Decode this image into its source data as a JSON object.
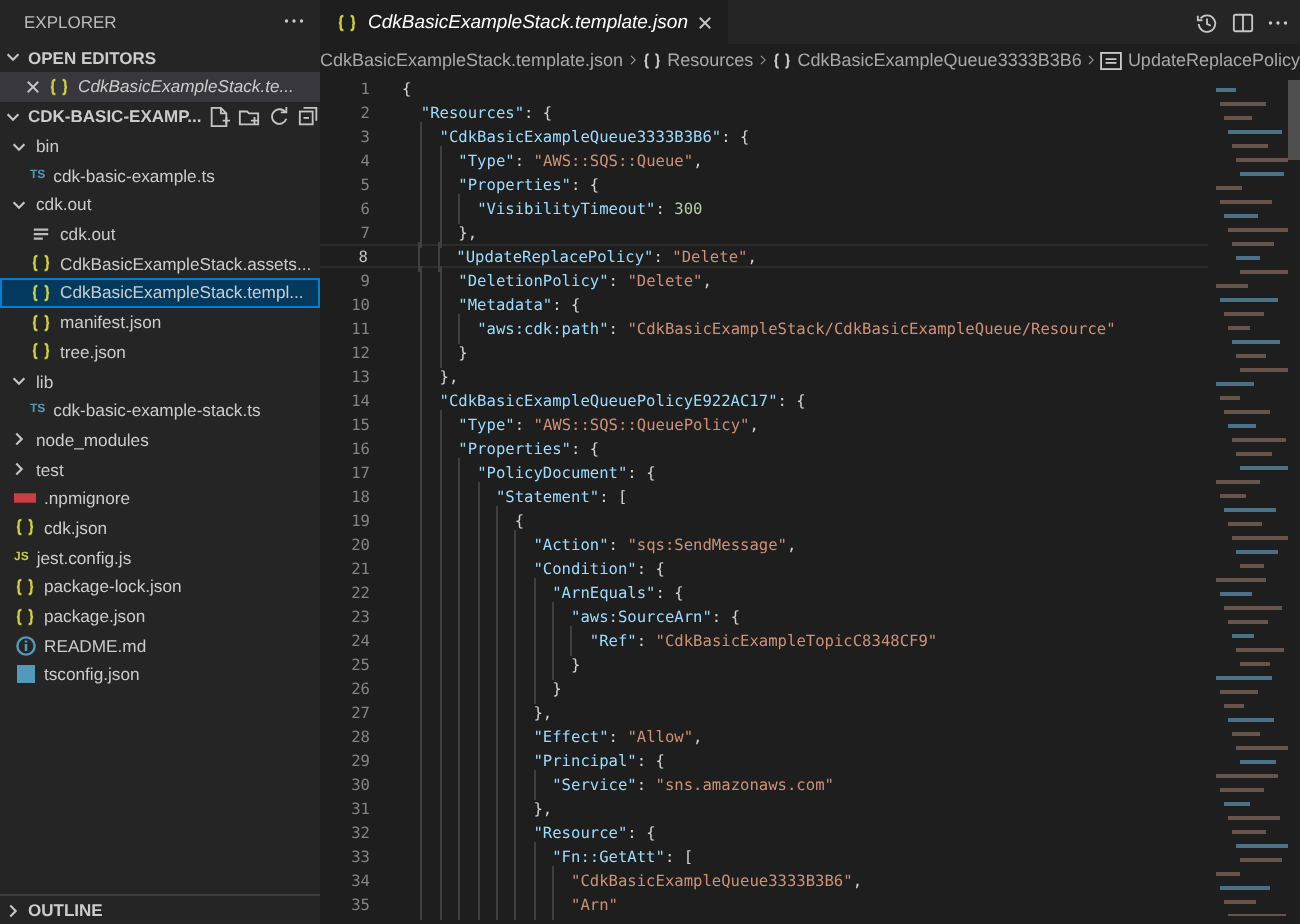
{
  "sidebar": {
    "title": "EXPLORER",
    "open_editors": {
      "title": "OPEN EDITORS",
      "expanded": true,
      "items": [
        {
          "label": "CdkBasicExampleStack.te...",
          "kind": "json",
          "selected": true
        }
      ]
    },
    "project": {
      "title": "CDK-BASIC-EXAMP...",
      "expanded": true,
      "items": [
        {
          "label": "bin",
          "kind": "folder",
          "expanded": true,
          "selected": false,
          "children": [
            {
              "label": "cdk-basic-example.ts",
              "kind": "ts",
              "badge": "TS",
              "selected": false
            }
          ]
        },
        {
          "label": "cdk.out",
          "kind": "folder",
          "expanded": true,
          "selected": false,
          "children": [
            {
              "label": "cdk.out",
              "kind": "text",
              "selected": false
            },
            {
              "label": "CdkBasicExampleStack.assets...",
              "kind": "json",
              "selected": false
            },
            {
              "label": "CdkBasicExampleStack.templ...",
              "kind": "json",
              "selected": true
            },
            {
              "label": "manifest.json",
              "kind": "json",
              "selected": false
            },
            {
              "label": "tree.json",
              "kind": "json",
              "selected": false
            }
          ]
        },
        {
          "label": "lib",
          "kind": "folder",
          "expanded": true,
          "selected": false,
          "children": [
            {
              "label": "cdk-basic-example-stack.ts",
              "kind": "ts",
              "badge": "TS",
              "selected": false
            }
          ]
        },
        {
          "label": "node_modules",
          "kind": "folder",
          "expanded": false,
          "selected": false
        },
        {
          "label": "test",
          "kind": "folder",
          "expanded": false,
          "selected": false
        },
        {
          "label": ".npmignore",
          "kind": "npm",
          "selected": false
        },
        {
          "label": "cdk.json",
          "kind": "json",
          "selected": false
        },
        {
          "label": "jest.config.js",
          "kind": "js",
          "badge": "JS",
          "selected": false
        },
        {
          "label": "package-lock.json",
          "kind": "json",
          "selected": false
        },
        {
          "label": "package.json",
          "kind": "json",
          "selected": false
        },
        {
          "label": "README.md",
          "kind": "info",
          "selected": false
        },
        {
          "label": "tsconfig.json",
          "kind": "tsconfig",
          "selected": false
        }
      ]
    },
    "outline": {
      "title": "OUTLINE",
      "expanded": false
    }
  },
  "tabs": [
    {
      "label": "CdkBasicExampleStack.template.json",
      "kind": "json",
      "selected": true
    }
  ],
  "breadcrumbs": [
    {
      "label": "CdkBasicExampleStack.template.json",
      "kind": "file"
    },
    {
      "label": "Resources",
      "kind": "object"
    },
    {
      "label": "CdkBasicExampleQueue3333B3B6",
      "kind": "object"
    },
    {
      "label": "UpdateReplacePolicy",
      "kind": "string"
    }
  ],
  "editor": {
    "lines": [
      {
        "number": "1",
        "text": "{",
        "current": false
      },
      {
        "number": "2",
        "text": "  \"Resources\": {",
        "current": false
      },
      {
        "number": "3",
        "text": "    \"CdkBasicExampleQueue3333B3B6\": {",
        "current": false
      },
      {
        "number": "4",
        "text": "      \"Type\": \"AWS::SQS::Queue\",",
        "current": false
      },
      {
        "number": "5",
        "text": "      \"Properties\": {",
        "current": false
      },
      {
        "number": "6",
        "text": "        \"VisibilityTimeout\": 300",
        "current": false
      },
      {
        "number": "7",
        "text": "      },",
        "current": false
      },
      {
        "number": "8",
        "text": "      \"UpdateReplacePolicy\": \"Delete\",",
        "current": true
      },
      {
        "number": "9",
        "text": "      \"DeletionPolicy\": \"Delete\",",
        "current": false
      },
      {
        "number": "10",
        "text": "      \"Metadata\": {",
        "current": false
      },
      {
        "number": "11",
        "text": "        \"aws:cdk:path\": \"CdkBasicExampleStack/CdkBasicExampleQueue/Resource\"",
        "current": false
      },
      {
        "number": "12",
        "text": "      }",
        "current": false
      },
      {
        "number": "13",
        "text": "    },",
        "current": false
      },
      {
        "number": "14",
        "text": "    \"CdkBasicExampleQueuePolicyE922AC17\": {",
        "current": false
      },
      {
        "number": "15",
        "text": "      \"Type\": \"AWS::SQS::QueuePolicy\",",
        "current": false
      },
      {
        "number": "16",
        "text": "      \"Properties\": {",
        "current": false
      },
      {
        "number": "17",
        "text": "        \"PolicyDocument\": {",
        "current": false
      },
      {
        "number": "18",
        "text": "          \"Statement\": [",
        "current": false
      },
      {
        "number": "19",
        "text": "            {",
        "current": false
      },
      {
        "number": "20",
        "text": "              \"Action\": \"sqs:SendMessage\",",
        "current": false
      },
      {
        "number": "21",
        "text": "              \"Condition\": {",
        "current": false
      },
      {
        "number": "22",
        "text": "                \"ArnEquals\": {",
        "current": false
      },
      {
        "number": "23",
        "text": "                  \"aws:SourceArn\": {",
        "current": false
      },
      {
        "number": "24",
        "text": "                    \"Ref\": \"CdkBasicExampleTopicC8348CF9\"",
        "current": false
      },
      {
        "number": "25",
        "text": "                  }",
        "current": false
      },
      {
        "number": "26",
        "text": "                }",
        "current": false
      },
      {
        "number": "27",
        "text": "              },",
        "current": false
      },
      {
        "number": "28",
        "text": "              \"Effect\": \"Allow\",",
        "current": false
      },
      {
        "number": "29",
        "text": "              \"Principal\": {",
        "current": false
      },
      {
        "number": "30",
        "text": "                \"Service\": \"sns.amazonaws.com\"",
        "current": false
      },
      {
        "number": "31",
        "text": "              },",
        "current": false
      },
      {
        "number": "32",
        "text": "              \"Resource\": {",
        "current": false
      },
      {
        "number": "33",
        "text": "                \"Fn::GetAtt\": [",
        "current": false
      },
      {
        "number": "34",
        "text": "                  \"CdkBasicExampleQueue3333B3B6\",",
        "current": false
      },
      {
        "number": "35",
        "text": "                  \"Arn\"",
        "current": false
      }
    ]
  }
}
